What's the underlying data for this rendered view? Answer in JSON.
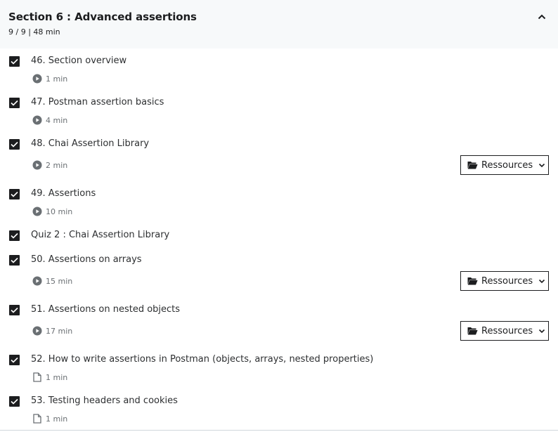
{
  "section": {
    "title": "Section 6 : Advanced assertions",
    "meta": "9 / 9 | 48 min",
    "expanded": true
  },
  "items": [
    {
      "title": "46. Section overview",
      "duration": "1 min",
      "kind": "video",
      "checked": true,
      "resources": false
    },
    {
      "title": "47. Postman assertion basics",
      "duration": "4 min",
      "kind": "video",
      "checked": true,
      "resources": false
    },
    {
      "title": "48. Chai Assertion Library",
      "duration": "2 min",
      "kind": "video",
      "checked": true,
      "resources": true
    },
    {
      "title": "49. Assertions",
      "duration": "10 min",
      "kind": "video",
      "checked": true,
      "resources": false
    },
    {
      "title": "Quiz 2 : Chai Assertion Library",
      "duration": "",
      "kind": "quiz",
      "checked": true,
      "resources": false
    },
    {
      "title": "50. Assertions on arrays",
      "duration": "15 min",
      "kind": "video",
      "checked": true,
      "resources": true
    },
    {
      "title": "51. Assertions on nested objects",
      "duration": "17 min",
      "kind": "video",
      "checked": true,
      "resources": true
    },
    {
      "title": "52. How to write assertions in Postman (objects, arrays, nested properties)",
      "duration": "1 min",
      "kind": "article",
      "checked": true,
      "resources": false
    },
    {
      "title": "53. Testing headers and cookies",
      "duration": "1 min",
      "kind": "article",
      "checked": true,
      "resources": false
    }
  ],
  "resources_label": "Ressources",
  "icons": {
    "video": "play-circle-icon",
    "article": "document-icon",
    "resources": "folder-open-icon",
    "collapse": "chevron-up-icon",
    "dropdown": "chevron-down-icon",
    "check": "checkmark-icon"
  },
  "colors": {
    "header_bg": "#f7f9fa",
    "checkbox": "#1c1d1f",
    "meta_text": "#6a6f73"
  }
}
